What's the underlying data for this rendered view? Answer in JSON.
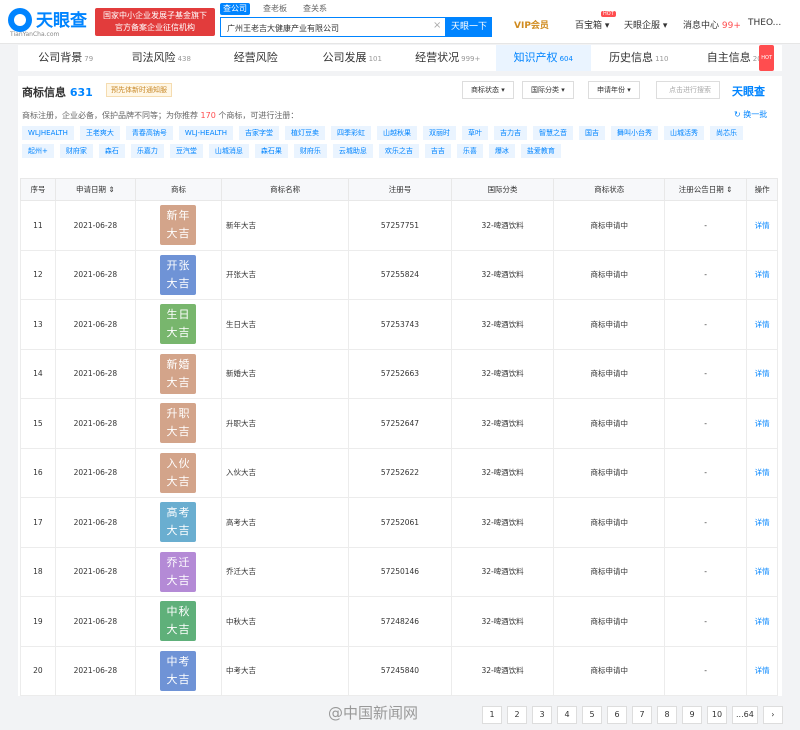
{
  "header": {
    "logo": "天眼查",
    "logo_sub": "TianYanCha.com",
    "banner": "国家中小企业发展子基金旗下 官方备案企业征信机构",
    "search_tabs": [
      "查公司",
      "查老板",
      "查关系"
    ],
    "search_value": "广州王老吉大健康产业有限公司",
    "search_button": "天眼一下",
    "vip": "VIP会员",
    "baibaoxiang": "百宝箱",
    "hot": "HOT",
    "guanjia": "天眼企服",
    "messages": "消息中心",
    "message_count": "99+",
    "user": "THEO..."
  },
  "tabs": [
    {
      "label": "公司背景",
      "count": "79"
    },
    {
      "label": "司法风险",
      "count": "438"
    },
    {
      "label": "经营风险",
      "count": ""
    },
    {
      "label": "公司发展",
      "count": "101"
    },
    {
      "label": "经营状况",
      "count": "999+"
    },
    {
      "label": "知识产权",
      "count": "604"
    },
    {
      "label": "历史信息",
      "count": "110"
    },
    {
      "label": "自主信息",
      "count": "20"
    }
  ],
  "section": {
    "title": "商标信息",
    "count": "631",
    "promo": "预先体新时通知服",
    "filters": [
      "商标状态",
      "国际分类",
      "申请年份"
    ],
    "search_placeholder": "点击进行搜索",
    "brand": "天眼查",
    "hint_pre": "商标注册，企业必备，保护品牌不同等；为你推荐",
    "hint_num": "170",
    "hint_post": "个商标，可进行注册：",
    "refresh": "换一批"
  },
  "chips": [
    "WLJHEALTH",
    "王老爽大",
    "青春高钠号",
    "WLJ-HEALTH",
    "吉家字堂",
    "植灯豆卖",
    "四季彩虹",
    "山越秋果",
    "双丽时",
    "草叶",
    "吉力吉",
    "智慧之音",
    "国吉",
    "舞叫小台秀",
    "山城活秀",
    "尚芯乐",
    "起州+",
    "财府家",
    "森石",
    "乐嘉力",
    "豆汽堂",
    "山城消息",
    "森石果",
    "财府乐",
    "云城助息",
    "欢乐之吉",
    "吉吉",
    "乐喜",
    "爆冰",
    "盐爱教育"
  ],
  "table": {
    "headers": [
      "序号",
      "申请日期",
      "商标",
      "商标名称",
      "注册号",
      "国际分类",
      "商标状态",
      "注册公告日期",
      "操作"
    ],
    "rows": [
      {
        "no": "11",
        "date": "2021-06-28",
        "mark1": "新年",
        "mark2": "大吉",
        "color": "#d3a48a",
        "name": "新年大吉",
        "reg": "57257751",
        "cls": "32-啤酒饮料",
        "status": "商标申请中",
        "ann": "-",
        "op": "详情"
      },
      {
        "no": "12",
        "date": "2021-06-28",
        "mark1": "开张",
        "mark2": "大吉",
        "color": "#6f93d6",
        "name": "开张大吉",
        "reg": "57255824",
        "cls": "32-啤酒饮料",
        "status": "商标申请中",
        "ann": "-",
        "op": "详情"
      },
      {
        "no": "13",
        "date": "2021-06-28",
        "mark1": "生日",
        "mark2": "大吉",
        "color": "#78b66d",
        "name": "生日大吉",
        "reg": "57253743",
        "cls": "32-啤酒饮料",
        "status": "商标申请中",
        "ann": "-",
        "op": "详情"
      },
      {
        "no": "14",
        "date": "2021-06-28",
        "mark1": "新婚",
        "mark2": "大吉",
        "color": "#d3a48a",
        "name": "新婚大吉",
        "reg": "57252663",
        "cls": "32-啤酒饮料",
        "status": "商标申请中",
        "ann": "-",
        "op": "详情"
      },
      {
        "no": "15",
        "date": "2021-06-28",
        "mark1": "升职",
        "mark2": "大吉",
        "color": "#d3a48a",
        "name": "升职大吉",
        "reg": "57252647",
        "cls": "32-啤酒饮料",
        "status": "商标申请中",
        "ann": "-",
        "op": "详情"
      },
      {
        "no": "16",
        "date": "2021-06-28",
        "mark1": "入伙",
        "mark2": "大吉",
        "color": "#d3a48a",
        "name": "入伙大吉",
        "reg": "57252622",
        "cls": "32-啤酒饮料",
        "status": "商标申请中",
        "ann": "-",
        "op": "详情"
      },
      {
        "no": "17",
        "date": "2021-06-28",
        "mark1": "高考",
        "mark2": "大吉",
        "color": "#6aaed0",
        "name": "高考大吉",
        "reg": "57252061",
        "cls": "32-啤酒饮料",
        "status": "商标申请中",
        "ann": "-",
        "op": "详情"
      },
      {
        "no": "18",
        "date": "2021-06-28",
        "mark1": "乔迁",
        "mark2": "大吉",
        "color": "#b48ad6",
        "name": "乔迁大吉",
        "reg": "57250146",
        "cls": "32-啤酒饮料",
        "status": "商标申请中",
        "ann": "-",
        "op": "详情"
      },
      {
        "no": "19",
        "date": "2021-06-28",
        "mark1": "中秋",
        "mark2": "大吉",
        "color": "#5fb07a",
        "name": "中秋大吉",
        "reg": "57248246",
        "cls": "32-啤酒饮料",
        "status": "商标申请中",
        "ann": "-",
        "op": "详情"
      },
      {
        "no": "20",
        "date": "2021-06-28",
        "mark1": "中考",
        "mark2": "大吉",
        "color": "#6f93d6",
        "name": "中考大吉",
        "reg": "57245840",
        "cls": "32-啤酒饮料",
        "status": "商标申请中",
        "ann": "-",
        "op": "详情"
      }
    ]
  },
  "footer": {
    "watermark": "@中国新闻网",
    "pages": [
      "1",
      "2",
      "3",
      "4",
      "5",
      "6",
      "7",
      "8",
      "9",
      "10",
      "...64"
    ],
    "next": "›"
  }
}
